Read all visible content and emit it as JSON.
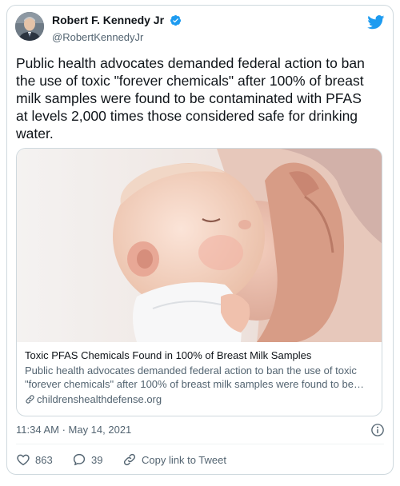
{
  "tweet": {
    "author": {
      "display_name": "Robert F. Kennedy Jr",
      "handle": "@RobertKennedyJr",
      "verified": true,
      "avatar_icon": "avatar-photo"
    },
    "text": "Public health advocates demanded federal action to ban the use of toxic \"forever chemicals\" after 100% of breast milk samples were found to be contaminated with PFAS at levels 2,000 times those considered safe for drinking water.",
    "card": {
      "title": "Toxic PFAS Chemicals Found in 100% of Breast Milk Samples",
      "description_line1": "Public health advocates demanded federal action to ban the use of toxic",
      "description_line2": "\"forever chemicals\" after 100% of breast milk samples were found to be…",
      "domain": "childrenshealthdefense.org"
    },
    "timestamp": "11:34 AM · May 14, 2021",
    "actions": {
      "like_count": "863",
      "reply_count": "39",
      "share_label": "Copy link to Tweet"
    }
  },
  "colors": {
    "twitter_blue": "#1d9bf0",
    "text_primary": "#0f1419",
    "text_secondary": "#536471",
    "border": "#cfd9de"
  }
}
